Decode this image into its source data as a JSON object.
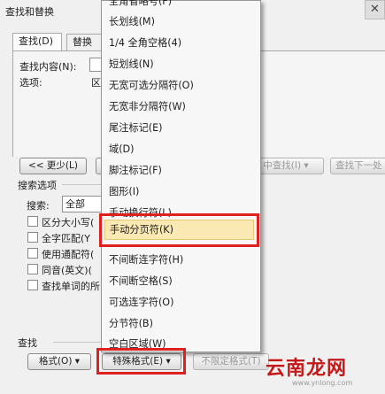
{
  "dialog": {
    "title": "查找和替换",
    "close_glyph": "✕"
  },
  "tabs": [
    {
      "label": "查找(D)"
    },
    {
      "label": "替换"
    }
  ],
  "find": {
    "label": "查找内容(N):",
    "options_label": "选项:",
    "options_value": "区"
  },
  "buttons": {
    "less": "<< 更少(L)",
    "find_prev": "中查找(Ⅰ) ▾",
    "find_next": "查找下一处",
    "format": "格式(O) ▾",
    "special": "特殊格式(E) ▾",
    "no_format": "不限定格式(T)"
  },
  "search_options": {
    "title": "搜索选项",
    "search_label": "搜索:",
    "search_value": "全部",
    "checkboxes": [
      {
        "label": "区分大小写("
      },
      {
        "label": "全字匹配(Y"
      },
      {
        "label": "使用通配符("
      },
      {
        "label": "同音(英文)("
      },
      {
        "label": "查找单词的所"
      }
    ]
  },
  "find_section_label": "查找",
  "menu": {
    "items": [
      {
        "label": "全角省略号(F)"
      },
      {
        "label": "长划线(M)"
      },
      {
        "label": "1/4 全角空格(4)"
      },
      {
        "label": "短划线(N)"
      },
      {
        "label": "无宽可选分隔符(O)"
      },
      {
        "label": "无宽非分隔符(W)"
      },
      {
        "label": "尾注标记(E)"
      },
      {
        "label": "域(D)"
      },
      {
        "label": "脚注标记(F)"
      },
      {
        "label": "图形(I)"
      },
      {
        "label": "手动换行符(L)"
      },
      {
        "label": "手动分页符(K)"
      },
      {
        "label": "不间断连字符(H)"
      },
      {
        "label": "不间断空格(S)"
      },
      {
        "label": "可选连字符(O)"
      },
      {
        "label": "分节符(B)"
      },
      {
        "label": "空白区域(W)"
      }
    ],
    "highlighted_index": 11,
    "highlight_color": "#e01f1f"
  },
  "watermark": {
    "text": "云南龙网",
    "url": "www.ynlong.com"
  }
}
